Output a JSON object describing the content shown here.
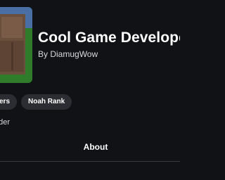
{
  "group": {
    "icon": "group-avatar-icon",
    "title": "Cool Game Develope",
    "byline": "By DiamugWow"
  },
  "tags": {
    "left_partial": "ers",
    "rank": "Noah Rank"
  },
  "description": "nder",
  "tabs": {
    "about": "About"
  },
  "colors": {
    "background": "#111216",
    "tag_background": "#2c2d33",
    "icon_green": "#2f7d2b",
    "icon_brown": "#6b4f3d"
  }
}
